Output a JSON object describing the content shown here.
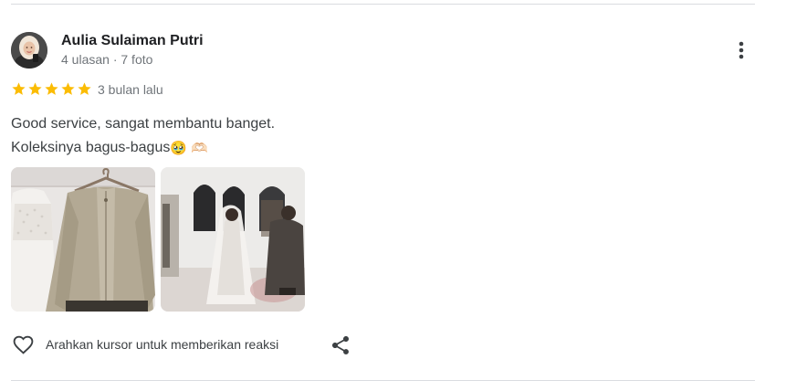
{
  "review": {
    "author_name": "Aulia Sulaiman Putri",
    "author_meta": "4 ulasan · 7 foto",
    "rating": 5,
    "time": "3 bulan lalu",
    "text": "Good service, sangat membantu banget. Koleksinya bagus-bagus",
    "emojis": "🥹 🫶🏻",
    "photos": [
      {
        "icon": "photo-jacket"
      },
      {
        "icon": "photo-bride"
      }
    ]
  },
  "actions": {
    "like_icon": "heart-outline-icon",
    "like_label": "Arahkan kursor untuk memberikan reaksi",
    "share_icon": "share-icon",
    "more_icon": "more-vertical-icon"
  },
  "colors": {
    "star": "#fbbc04",
    "divider": "#dadce0",
    "meta_text": "#70757a",
    "body_text": "#3c4043"
  }
}
